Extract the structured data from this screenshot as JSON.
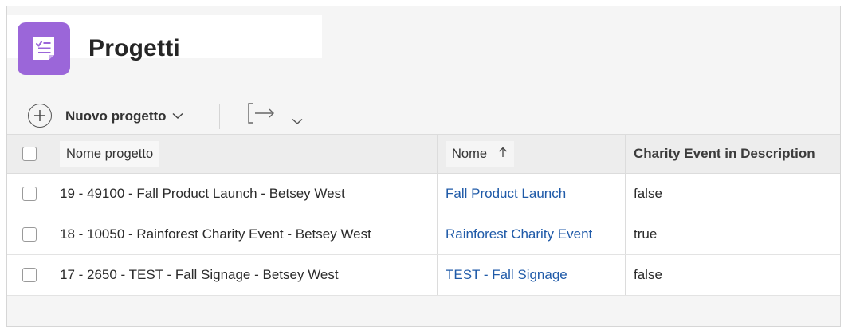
{
  "header": {
    "title": "Progetti",
    "icon": "checklist-icon",
    "icon_color": "#9b66d9"
  },
  "toolbar": {
    "new_project_label": "Nuovo progetto",
    "new_project_icon": "plus-circle-icon",
    "export_icon": "export-arrow-icon"
  },
  "table": {
    "columns": [
      {
        "label": "Nome progetto"
      },
      {
        "label": "Nome",
        "sort": "ascending"
      },
      {
        "label": "Charity Event in Description"
      }
    ],
    "rows": [
      {
        "project": "19 - 49100 - Fall Product Launch - Betsey West",
        "name": "Fall Product Launch",
        "charity": "false"
      },
      {
        "project": "18 - 10050 - Rainforest Charity Event - Betsey West",
        "name": "Rainforest Charity Event",
        "charity": "true"
      },
      {
        "project": "17 - 2650 - TEST - Fall Signage - Betsey West",
        "name": "TEST - Fall Signage",
        "charity": "false"
      }
    ]
  },
  "colors": {
    "link": "#1f5aa8",
    "accent": "#9b66d9"
  }
}
